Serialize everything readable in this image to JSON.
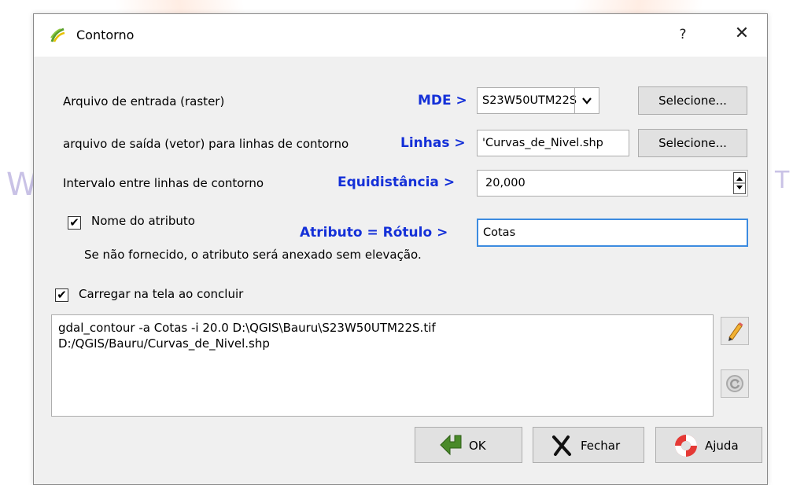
{
  "window": {
    "title": "Contorno",
    "help_label": "?",
    "close_label": "✕"
  },
  "background": {
    "left_glyph": "W",
    "right_glyph": "T"
  },
  "rows": {
    "input": {
      "label": "Arquivo de entrada (raster)",
      "annotation": "MDE >",
      "value": "S23W50UTM22S",
      "button": "Selecione..."
    },
    "output": {
      "label": "arquivo de saída (vetor) para linhas de contorno",
      "annotation": "Linhas >",
      "value": "'Curvas_de_Nivel.shp",
      "button": "Selecione..."
    },
    "interval": {
      "label": "Intervalo entre linhas de contorno",
      "annotation": "Equidistância >",
      "value": "20,000"
    },
    "attribute": {
      "label": "Nome do atributo",
      "checked": true,
      "hint": "Se não fornecido, o atributo será anexado sem elevação.",
      "annotation": "Atributo = Rótulo >",
      "value": "Cotas"
    }
  },
  "load_on_finish": {
    "label": "Carregar na tela ao concluir",
    "checked": true
  },
  "command": {
    "line1": "gdal_contour -a Cotas -i 20.0 D:\\QGIS\\Bauru\\S23W50UTM22S.tif",
    "line2": "D:/QGIS/Bauru/Curvas_de_Nivel.shp"
  },
  "side_buttons": {
    "edit_icon": "pencil-icon",
    "reset_icon": "reset-icon"
  },
  "buttons": {
    "ok": "OK",
    "close": "Fechar",
    "help": "Ajuda"
  },
  "colors": {
    "annotation": "#1430d8",
    "dialog_bg": "#f0f0f0",
    "focus_border": "#3c8be0"
  }
}
